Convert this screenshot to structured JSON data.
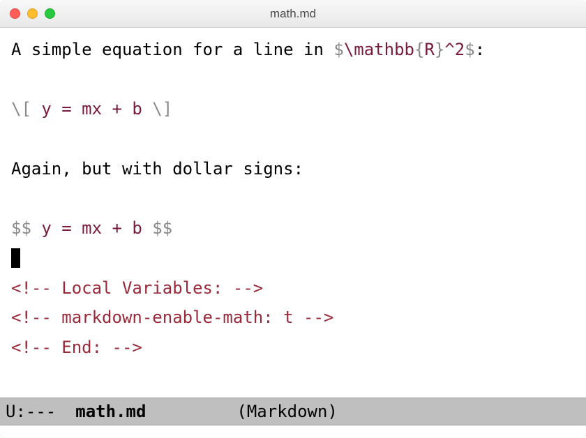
{
  "window": {
    "title": "math.md"
  },
  "editor": {
    "line1_pre": "A simple equation for a line in ",
    "line1_delim1": "$",
    "line1_mathbb": "\\mathbb",
    "line1_lb": "{",
    "line1_R": "R",
    "line1_rb": "}",
    "line1_caret": "^",
    "line1_two": "2",
    "line1_delim2": "$",
    "line1_colon": ":",
    "line3_open": "\\[",
    "line3_body": " y = mx + b ",
    "line3_close": "\\]",
    "line5": "Again, but with dollar signs:",
    "line7_open": "$$",
    "line7_body": " y = mx + b ",
    "line7_close": "$$",
    "comment1_open": "<!--",
    "comment1_body": " Local Variables: ",
    "comment1_close": "-->",
    "comment2_open": "<!--",
    "comment2_body": " markdown-enable-math: t ",
    "comment2_close": "-->",
    "comment3_open": "<!--",
    "comment3_body": " End: ",
    "comment3_close": "-->"
  },
  "modeline": {
    "status": "U:---",
    "buffer_name": "math.md",
    "mode": "(Markdown)"
  }
}
